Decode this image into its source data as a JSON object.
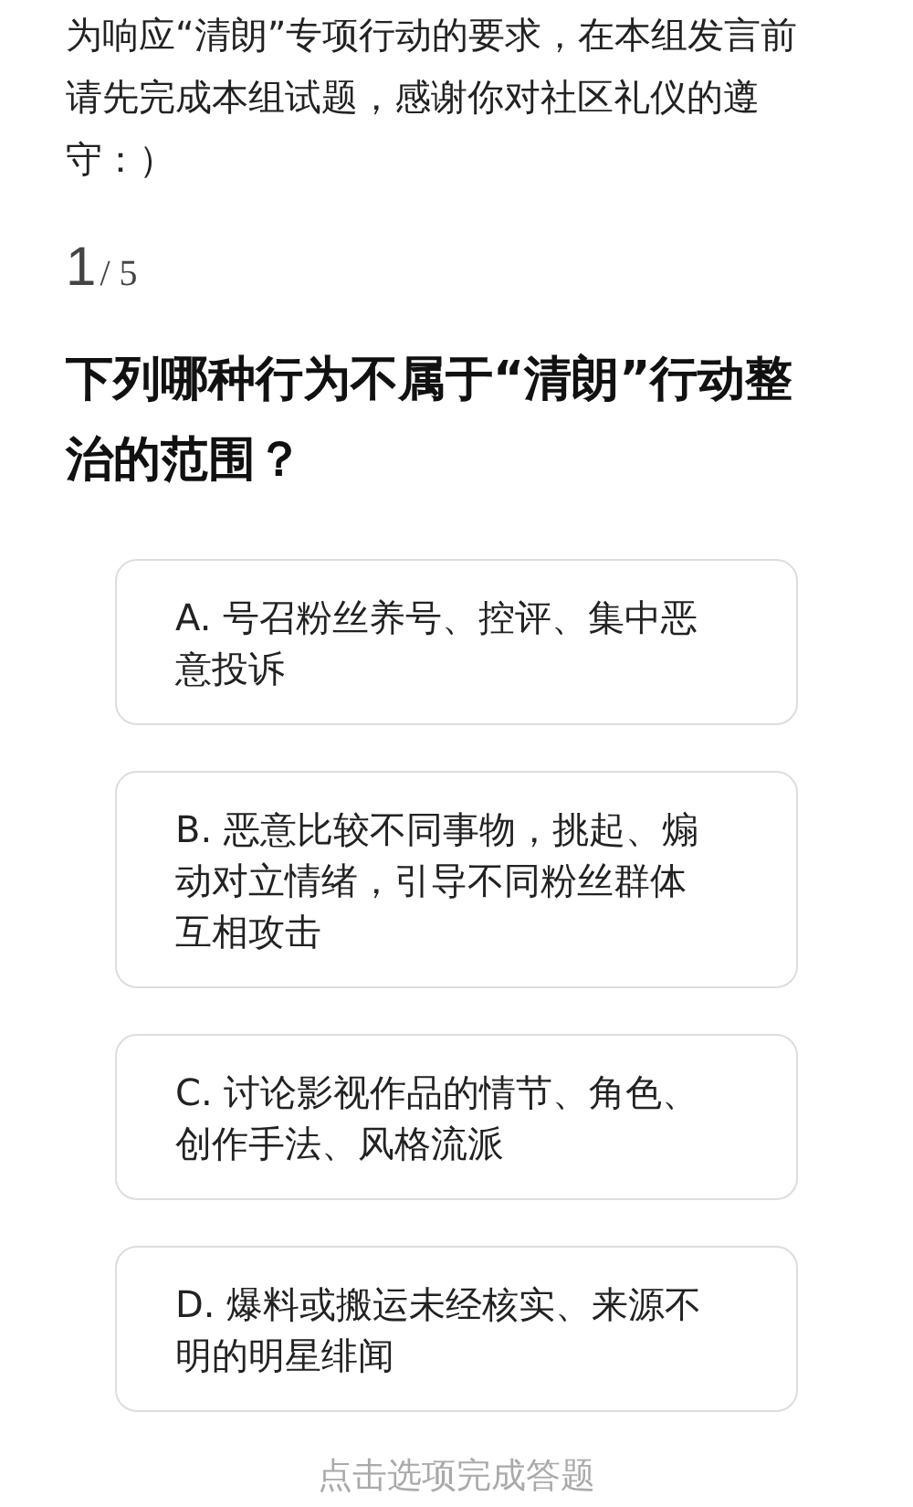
{
  "intro": "为响应“清朗”专项行动的要求，在本组发言前请先完成本组试题，感谢你对社区礼仪的遵守：）",
  "progress": {
    "current": "1",
    "total": "/ 5"
  },
  "question": "下列哪种行为不属于“清朗”行动整治的范围？",
  "options": [
    {
      "label": "A. 号召粉丝养号、控评、集中恶意投诉"
    },
    {
      "label": "B. 恶意比较不同事物，挑起、煽动对立情绪，引导不同粉丝群体互相攻击"
    },
    {
      "label": "C. 讨论影视作品的情节、角色、创作手法、风格流派"
    },
    {
      "label": "D. 爆料或搬运未经核实、来源不明的明星绯闻"
    }
  ],
  "hint": "点击选项完成答题"
}
